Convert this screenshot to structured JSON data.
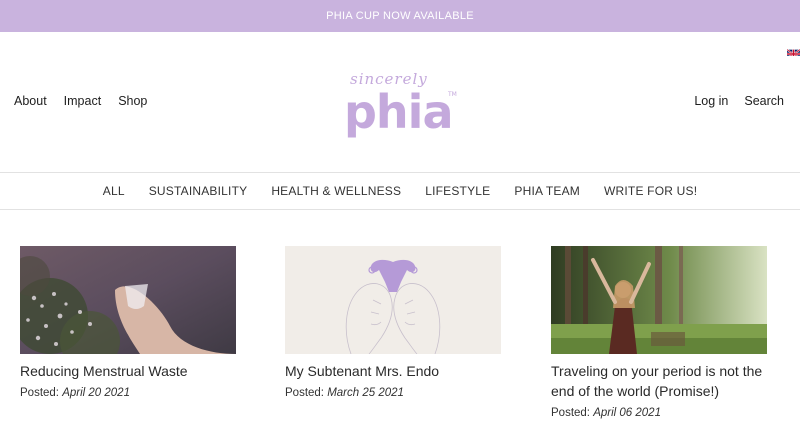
{
  "announcement": "PHIA CUP NOW AVAILABLE",
  "nav_left": [
    "About",
    "Impact",
    "Shop"
  ],
  "nav_right": [
    "Log in",
    "Search"
  ],
  "logo": {
    "script": "sincerely",
    "word": "phia",
    "mark": "TM"
  },
  "categories": [
    "ALL",
    "SUSTAINABILITY",
    "HEALTH & WELLNESS",
    "LIFESTYLE",
    "PHIA TEAM",
    "WRITE FOR US!"
  ],
  "posts": [
    {
      "title": "Reducing Menstrual Waste",
      "posted_label": "Posted:",
      "date": "April 20 2021"
    },
    {
      "title": "My Subtenant Mrs. Endo",
      "posted_label": "Posted:",
      "date": "March 25 2021"
    },
    {
      "title": "Traveling on your period is not the end of the world (Promise!)",
      "posted_label": "Posted:",
      "date": "April 06 2021"
    }
  ],
  "colors": {
    "brand": "#c9b3de",
    "logo": "#c4a9dc"
  }
}
